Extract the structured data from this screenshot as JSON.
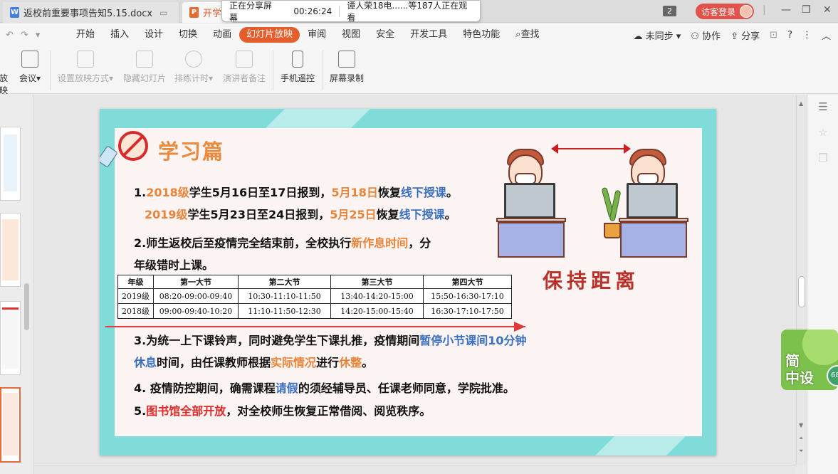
{
  "tabs": [
    {
      "label": "返校前重要事项告知5.15.docx",
      "type": "word"
    },
    {
      "label": "开学",
      "type": "ppt"
    }
  ],
  "sharing": {
    "status": "正在分享屏幕",
    "time": "00:26:24",
    "viewers": "谭人荣18电......等187人正在观看"
  },
  "window_count": "2",
  "visitor_login": "访客登录",
  "menu": {
    "items": [
      "开始",
      "插入",
      "设计",
      "切换",
      "动画",
      "幻灯片放映",
      "审阅",
      "视图",
      "安全",
      "开发工具",
      "特色功能"
    ],
    "active": "幻灯片放映",
    "search": "查找",
    "sync": "未同步",
    "collab": "协作",
    "share": "分享"
  },
  "ribbon": {
    "partial": "放映",
    "meeting": "会议",
    "setup_show": "设置放映方式",
    "hide_slide": "隐藏幻灯片",
    "rehearse": "排练计时",
    "presenter_notes": "演讲者备注",
    "phone_remote": "手机遥控",
    "screen_record": "屏幕录制"
  },
  "slide": {
    "title": "学习篇",
    "keep_distance": "保持距离",
    "l1": {
      "a": "1.",
      "b": "2018级",
      "c": "学生5月16日至17日报到，",
      "d": "5月18日",
      "e": "恢复",
      "f": "线下授课",
      "g": "。"
    },
    "l2": {
      "b": "2019级",
      "c": "学生5月23日至24日报到，",
      "d": "5月25日",
      "e": "恢复",
      "f": "线下授课",
      "g": "。"
    },
    "l3": {
      "a": "2.师生返校后至疫情完全结束前，全校执行",
      "b": "新作息时间",
      "c": "，分"
    },
    "l4": "年级错时上课。",
    "table": {
      "headers": [
        "年级",
        "第一大节",
        "第二大节",
        "第三大节",
        "第四大节"
      ],
      "rows": [
        [
          "2019级",
          "08:20-09:00-09:40",
          "10:30-11:10-11:50",
          "13:40-14:20-15:00",
          "15:50-16:30-17:10"
        ],
        [
          "2018级",
          "09:00-09:40-10:20",
          "11:10-11:50-12:30",
          "14:20-15:00-15:40",
          "16:30-17:10-17:50"
        ]
      ]
    },
    "l5": {
      "a": "3.为统一上下课铃声，同时避免学生下课扎推，疫情期间",
      "b": "暂停小节课间10分钟"
    },
    "l6": {
      "a": "休息",
      "b": "时间，由任课教师根据",
      "c": "实际情况",
      "d": "进行",
      "e": "休整",
      "f": "。"
    },
    "l7": {
      "a": "4. 疫情防控期间，确需课程",
      "b": "请假",
      "c": "的须经辅导员、任课老师同意，学院批准。"
    },
    "l8": {
      "a": "5.",
      "b": "图书馆全部开放",
      "c": "，对全校师生恢复正常借阅、阅览秩序。"
    }
  },
  "widget": {
    "line1": "简",
    "line2": "中设",
    "badge": "68"
  }
}
